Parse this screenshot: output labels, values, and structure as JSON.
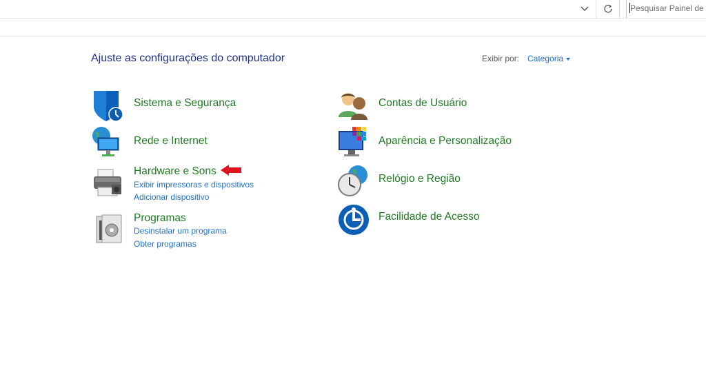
{
  "search": {
    "placeholder": "Pesquisar Painel de Controle"
  },
  "header": {
    "title": "Ajuste as configurações do computador",
    "view_by_label": "Exibir por:",
    "view_by_value": "Categoria"
  },
  "categories": [
    {
      "title": "Sistema e Segurança",
      "icon": "shield-icon",
      "links": []
    },
    {
      "title": "Rede e Internet",
      "icon": "network-icon",
      "links": []
    },
    {
      "title": "Hardware e Sons",
      "icon": "printer-icon",
      "links": [
        "Exibir impressoras e dispositivos",
        "Adicionar dispositivo"
      ]
    },
    {
      "title": "Programas",
      "icon": "programs-icon",
      "links": [
        "Desinstalar um programa",
        "Obter programas"
      ]
    },
    {
      "title": "Contas de Usuário",
      "icon": "users-icon",
      "links": []
    },
    {
      "title": "Aparência e Personalização",
      "icon": "appearance-icon",
      "links": []
    },
    {
      "title": "Relógio e Região",
      "icon": "clock-globe-icon",
      "links": []
    },
    {
      "title": "Facilidade de Acesso",
      "icon": "ease-of-access-icon",
      "links": []
    }
  ],
  "colors": {
    "category": "#1f7a22",
    "link": "#1f6fc8",
    "title": "#1e3287",
    "arrow": "#e0141e"
  }
}
